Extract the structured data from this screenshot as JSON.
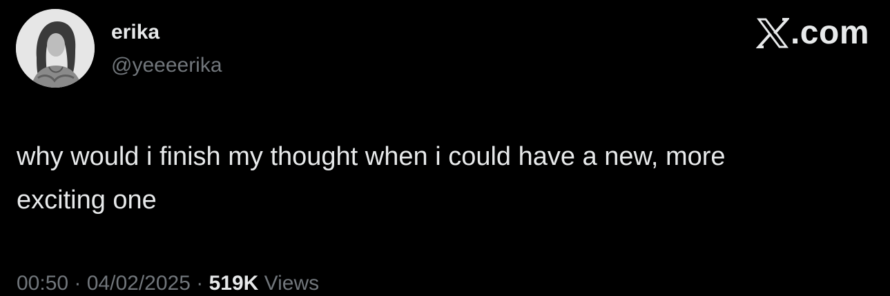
{
  "author": {
    "name": "erika",
    "handle": "@yeeeerika",
    "avatar_icon": "profile-photo"
  },
  "brand": {
    "icon": "x-logo-icon",
    "text": ".com"
  },
  "tweet": {
    "text": "why would i finish my thought when i could have a new, more\nexciting one"
  },
  "meta": {
    "time": "00:50",
    "separator": " · ",
    "date": "04/02/2025",
    "views_count": "519K",
    "views_label": " Views"
  },
  "colors": {
    "background": "#000000",
    "primary_text": "#e7e9ea",
    "secondary_text": "#71767b"
  }
}
